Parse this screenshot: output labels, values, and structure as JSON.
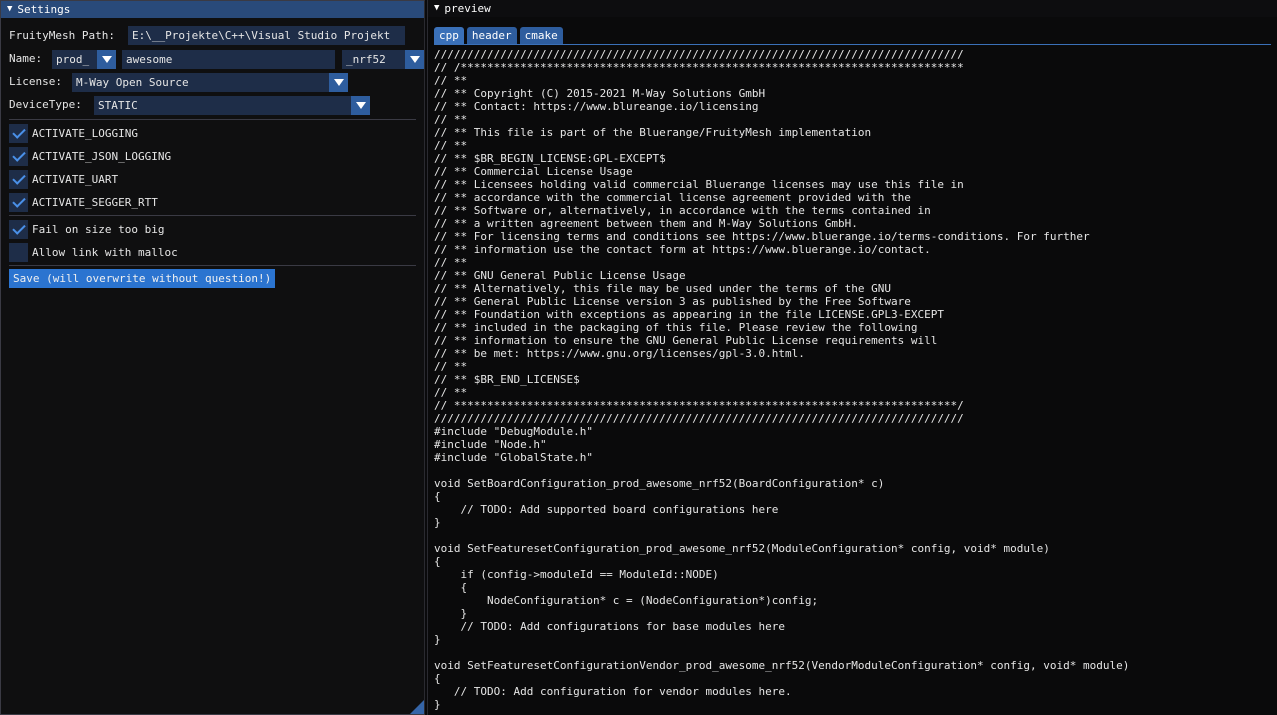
{
  "settings": {
    "title": "Settings",
    "path_label": "FruityMesh Path:",
    "path_value": "E:\\__Projekte\\C++\\Visual Studio Projekt",
    "name_label": "Name:",
    "name_prefix": "prod_",
    "name_value": "awesome",
    "name_suffix": "_nrf52",
    "license_label": "License:",
    "license_value": "M-Way Open Source",
    "device_type_label": "DeviceType:",
    "device_type_value": "STATIC",
    "checkboxes": [
      {
        "label": "ACTIVATE_LOGGING",
        "checked": true
      },
      {
        "label": "ACTIVATE_JSON_LOGGING",
        "checked": true
      },
      {
        "label": "ACTIVATE_UART",
        "checked": true
      },
      {
        "label": "ACTIVATE_SEGGER_RTT",
        "checked": true
      }
    ],
    "options": [
      {
        "label": "Fail on size too big",
        "checked": true
      },
      {
        "label": "Allow link with malloc",
        "checked": false
      }
    ],
    "save_label": "Save (will overwrite without question!)"
  },
  "preview": {
    "title": "preview",
    "tabs": [
      "cpp",
      "header",
      "cmake"
    ],
    "active_tab": "cpp",
    "code": [
      "////////////////////////////////////////////////////////////////////////////////",
      "// /****************************************************************************",
      "// **",
      "// ** Copyright (C) 2015-2021 M-Way Solutions GmbH",
      "// ** Contact: https://www.blureange.io/licensing",
      "// **",
      "// ** This file is part of the Bluerange/FruityMesh implementation",
      "// **",
      "// ** $BR_BEGIN_LICENSE:GPL-EXCEPT$",
      "// ** Commercial License Usage",
      "// ** Licensees holding valid commercial Bluerange licenses may use this file in",
      "// ** accordance with the commercial license agreement provided with the",
      "// ** Software or, alternatively, in accordance with the terms contained in",
      "// ** a written agreement between them and M-Way Solutions GmbH.",
      "// ** For licensing terms and conditions see https://www.bluerange.io/terms-conditions. For further",
      "// ** information use the contact form at https://www.bluerange.io/contact.",
      "// **",
      "// ** GNU General Public License Usage",
      "// ** Alternatively, this file may be used under the terms of the GNU",
      "// ** General Public License version 3 as published by the Free Software",
      "// ** Foundation with exceptions as appearing in the file LICENSE.GPL3-EXCEPT",
      "// ** included in the packaging of this file. Please review the following",
      "// ** information to ensure the GNU General Public License requirements will",
      "// ** be met: https://www.gnu.org/licenses/gpl-3.0.html.",
      "// **",
      "// ** $BR_END_LICENSE$",
      "// **",
      "// ****************************************************************************/",
      "////////////////////////////////////////////////////////////////////////////////",
      "#include \"DebugModule.h\"",
      "#include \"Node.h\"",
      "#include \"GlobalState.h\"",
      "",
      "void SetBoardConfiguration_prod_awesome_nrf52(BoardConfiguration* c)",
      "{",
      "    // TODO: Add supported board configurations here",
      "}",
      "",
      "void SetFeaturesetConfiguration_prod_awesome_nrf52(ModuleConfiguration* config, void* module)",
      "{",
      "    if (config->moduleId == ModuleId::NODE)",
      "    {",
      "        NodeConfiguration* c = (NodeConfiguration*)config;",
      "    }",
      "    // TODO: Add configurations for base modules here",
      "}",
      "",
      "void SetFeaturesetConfigurationVendor_prod_awesome_nrf52(VendorModuleConfiguration* config, void* module)",
      "{",
      "   // TODO: Add configuration for vendor modules here.",
      "}"
    ]
  }
}
